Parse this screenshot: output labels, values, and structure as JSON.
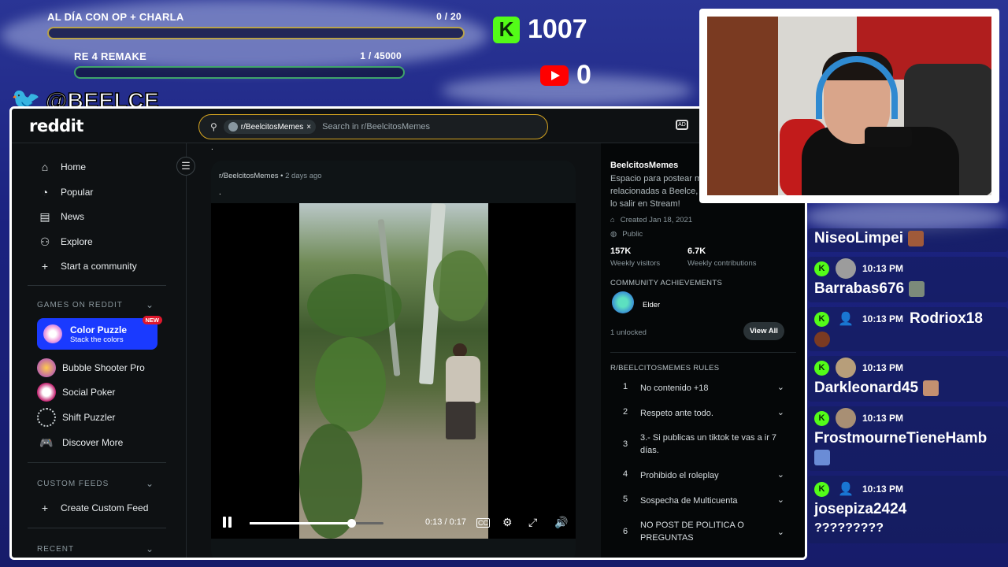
{
  "goals": [
    {
      "name": "AL DÍA CON OP + CHARLA",
      "count": "0 / 20",
      "progress": 0
    },
    {
      "name": "RE 4 REMAKE",
      "count": "1 / 45000",
      "progress": 2e-05
    }
  ],
  "counters": {
    "kick": "1007",
    "youtube": "0"
  },
  "twitter": {
    "handle": "@BEELCE_"
  },
  "reddit": {
    "logo": "reddit",
    "search": {
      "chip": "r/BeelcitosMemes",
      "chip_close": "×",
      "placeholder": "Search in r/BeelcitosMemes"
    },
    "nav": [
      "Home",
      "Popular",
      "News",
      "Explore",
      "Start a community"
    ],
    "games_header": "GAMES ON REDDIT",
    "featured_game": {
      "title": "Color Puzzle",
      "subtitle": "Stack the colors",
      "badge": "NEW"
    },
    "games": [
      "Bubble Shooter Pro",
      "Social Poker",
      "Shift Puzzler",
      "Discover More"
    ],
    "custom_feeds_header": "CUSTOM FEEDS",
    "create_feed": "Create Custom Feed",
    "recent_header": "RECENT",
    "post": {
      "subreddit": "r/BeelcitosMemes",
      "ago": "2 days ago",
      "body": ".",
      "above_dot": ".",
      "video": {
        "current": "0:13",
        "duration": "0:17",
        "progress": 0.76
      }
    },
    "sidebar_right": {
      "name": "BeelcitosMemes",
      "description": "Espacio para postear m relacionadas a Beelce, lo salir en Stream!",
      "created": "Created Jan 18, 2021",
      "visibility": "Public",
      "stats": [
        {
          "value": "157K",
          "label": "Weekly visitors"
        },
        {
          "value": "6.7K",
          "label": "Weekly contributions"
        }
      ],
      "achievements_header": "COMMUNITY ACHIEVEMENTS",
      "achievement": "Elder",
      "unlocked": "1 unlocked",
      "view_all": "View All",
      "rules_header": "R/BEELCITOSMEMES RULES",
      "rules": [
        {
          "n": "1",
          "text": "No contenido +18"
        },
        {
          "n": "2",
          "text": "Respeto ante todo."
        },
        {
          "n": "3",
          "text": "3.- Si publicas un tiktok te vas a ir 7 días."
        },
        {
          "n": "4",
          "text": "Prohibido el roleplay"
        },
        {
          "n": "5",
          "text": "Sospecha de Multicuenta"
        },
        {
          "n": "6",
          "text": "NO POST DE POLITICA O PREGUNTAS"
        }
      ]
    }
  },
  "chat": [
    {
      "user": "NiseoLimpei",
      "time": ""
    },
    {
      "user": "Barrabas676",
      "time": "10:13 PM"
    },
    {
      "user": "Rodriox18",
      "time": "10:13 PM"
    },
    {
      "user": "Darkleonard45",
      "time": "10:13 PM"
    },
    {
      "user": "FrostmourneTieneHamb",
      "time": "10:13 PM"
    },
    {
      "user": "josepiza2424",
      "time": "10:13 PM",
      "text": "?????????"
    }
  ],
  "colors": {
    "kick": "#53fc18",
    "youtube": "#ff0000",
    "reddit_bg": "#0e1113",
    "featured": "#1a3aff",
    "search_border": "#d6a520"
  }
}
